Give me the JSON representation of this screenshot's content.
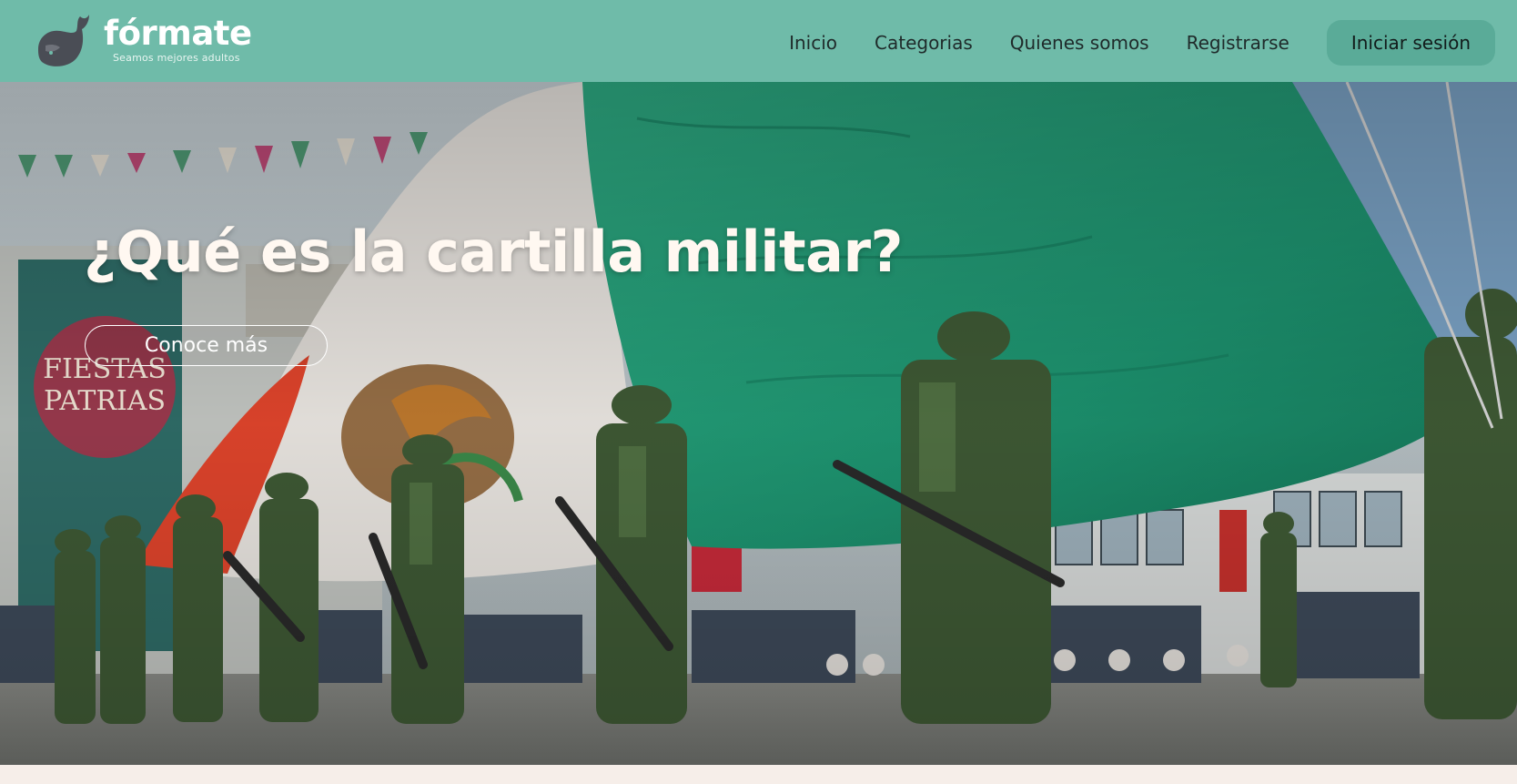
{
  "brand": {
    "name": "fórmate",
    "tagline": "Seamos mejores adultos",
    "logo_icon": "whale-icon"
  },
  "nav": {
    "items": [
      {
        "label": "Inicio"
      },
      {
        "label": "Categorias"
      },
      {
        "label": "Quienes somos"
      },
      {
        "label": "Registrarse"
      }
    ],
    "login_label": "Iniciar sesión"
  },
  "hero": {
    "title": "¿Qué es la cartilla militar?",
    "cta_label": "Conoce más",
    "image_description_icon": "flag-ceremony-photo"
  },
  "colors": {
    "navbar": "#6fbba9",
    "login_button": "#5aab98",
    "page_background": "#f6eee9",
    "flag_green": "#1f9a72",
    "flag_red": "#e2452c"
  }
}
